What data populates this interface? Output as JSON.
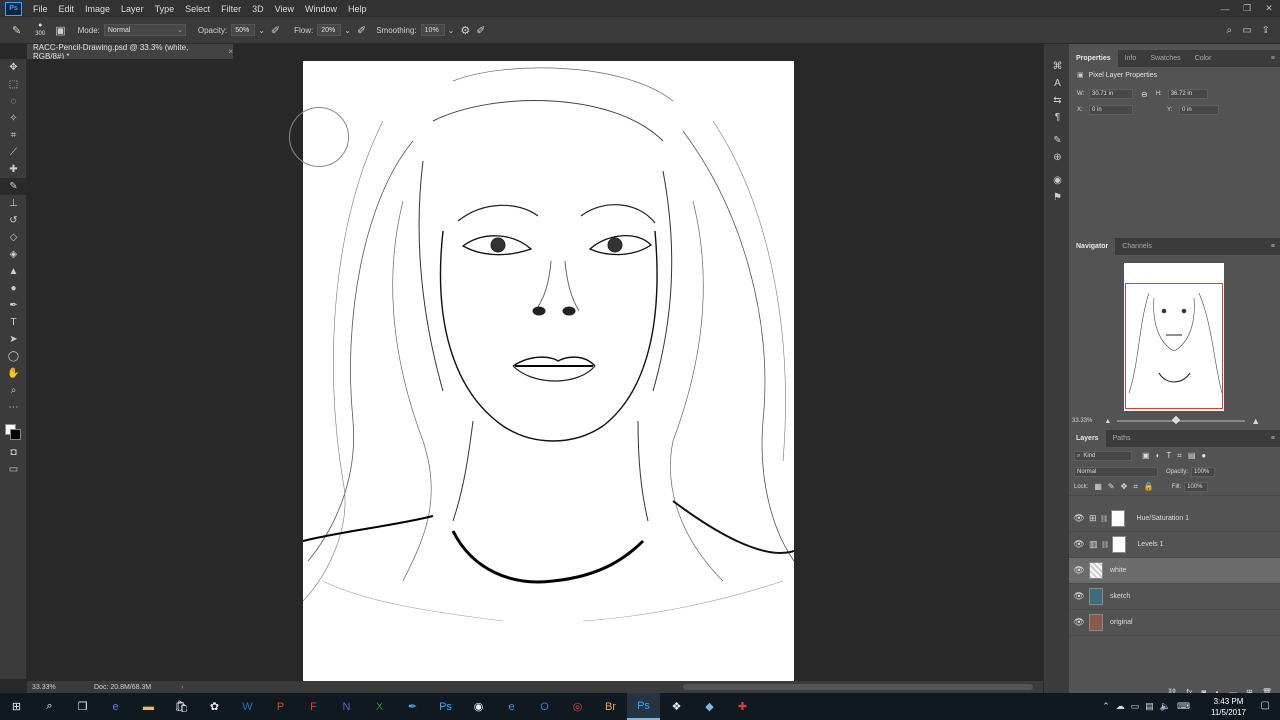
{
  "menubar": {
    "logo": "Ps",
    "items": [
      "File",
      "Edit",
      "Image",
      "Layer",
      "Type",
      "Select",
      "Filter",
      "3D",
      "View",
      "Window",
      "Help"
    ]
  },
  "options": {
    "brush_size": "300",
    "mode_label": "Mode:",
    "mode_value": "Normal",
    "opacity_label": "Opacity:",
    "opacity_value": "50%",
    "flow_label": "Flow:",
    "flow_value": "20%",
    "smoothing_label": "Smoothing:",
    "smoothing_value": "10%"
  },
  "document": {
    "tab_title": "RACC-Pencil-Drawing.psd @ 33.3% (white, RGB/8#) *"
  },
  "status": {
    "zoom": "33.33%",
    "doc_size": "Doc: 20.8M/68.3M"
  },
  "properties": {
    "tabs": [
      "Properties",
      "Info",
      "Swatches",
      "Color"
    ],
    "title": "Pixel Layer Properties",
    "w_label": "W:",
    "w_value": "30.71 in",
    "h_label": "H:",
    "h_value": "36.72 in",
    "x_label": "X:",
    "x_value": "0 in",
    "y_label": "Y:",
    "y_value": "0 in"
  },
  "navigator": {
    "tabs": [
      "Navigator",
      "Channels"
    ],
    "zoom": "33.33%",
    "view_box_color": "#e23a3a"
  },
  "layers": {
    "tabs": [
      "Layers",
      "Paths"
    ],
    "filter_label": "Kind",
    "blend_mode": "Normal",
    "opacity_label": "Opacity:",
    "opacity_value": "100%",
    "lock_label": "Lock:",
    "fill_label": "Fill:",
    "fill_value": "100%",
    "items": [
      {
        "name": "Hue/Saturation 1",
        "type": "adjustment"
      },
      {
        "name": "Levels 1",
        "type": "adjustment"
      },
      {
        "name": "white",
        "type": "pixel",
        "selected": true
      },
      {
        "name": "sketch",
        "type": "pixel"
      },
      {
        "name": "original",
        "type": "pixel"
      }
    ]
  },
  "taskbar": {
    "time": "3:43 PM",
    "date": "11/5/2017"
  },
  "colors": {
    "accent": "#31a8ff",
    "panel_bg": "#535353",
    "app_bg": "#282828"
  }
}
